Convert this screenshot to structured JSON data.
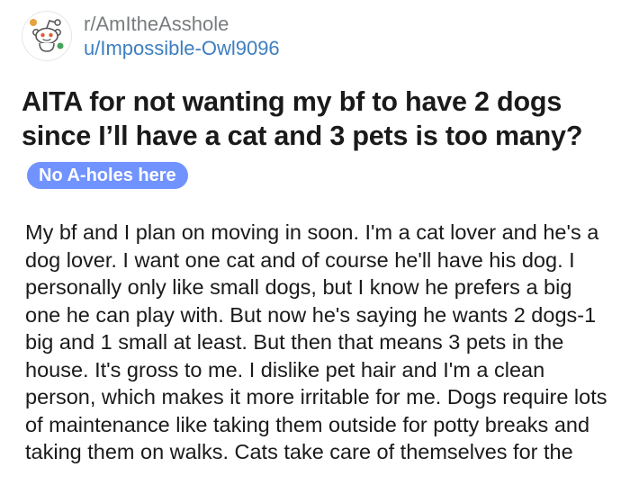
{
  "post": {
    "subreddit": "r/AmItheAsshole",
    "author": "u/Impossible-Owl9096",
    "title": "AITA for not wanting my bf to have 2 dogs since I’ll have a cat and 3 pets is too many?",
    "flair": "No A-holes here",
    "flair_color": "#7193ff",
    "body": "My bf and I plan on moving in soon. I'm a cat lover and he's a dog lover. I want one cat and of course he'll have his dog. I personally only like small dogs, but I know he prefers a big one he can play with. But now he's saying he wants 2 dogs-1 big and 1 small at least. But then that means 3 pets in the house. It's gross to me. I dislike pet hair and I'm a clean person, which makes it more irritable for me. Dogs require lots of maintenance like taking them outside for potty breaks and taking them on walks. Cats take care of themselves for the"
  },
  "icons": {
    "avatar": "reddit-snoo-avatar-icon"
  },
  "colors": {
    "subreddit_text": "#787c7e",
    "username_text": "#3d7fbf",
    "title_text": "#1a1a1b"
  }
}
